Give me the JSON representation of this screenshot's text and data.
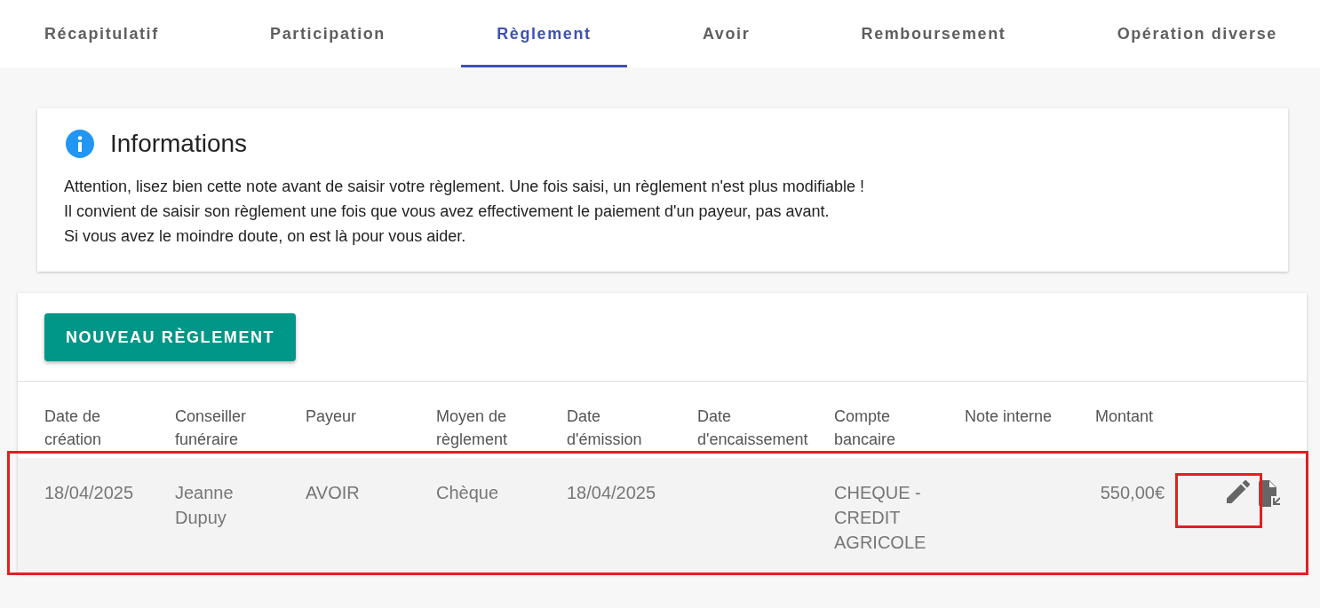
{
  "tabs": [
    {
      "label": "Récapitulatif",
      "selected": false
    },
    {
      "label": "Participation",
      "selected": false
    },
    {
      "label": "Règlement",
      "selected": true
    },
    {
      "label": "Avoir",
      "selected": false
    },
    {
      "label": "Remboursement",
      "selected": false
    },
    {
      "label": "Opération diverse",
      "selected": false
    }
  ],
  "info_card": {
    "title": "Informations",
    "lines": [
      "Attention, lisez bien cette note avant de saisir votre règlement. Une fois saisi, un règlement n'est plus modifiable !",
      "Il convient de saisir son règlement une fois que vous avez effectivement le paiement d'un payeur, pas avant.",
      "Si vous avez le moindre doute, on est là pour vous aider."
    ]
  },
  "new_button": "NOUVEAU RÈGLEMENT",
  "table": {
    "columns": [
      "Date de\ncréation",
      "Conseiller\nfunéraire",
      "Payeur",
      "Moyen de\nrèglement",
      "Date\nd'émission",
      "Date\nd'encaissement",
      "Compte\nbancaire",
      "Note interne",
      "Montant"
    ],
    "rows": [
      {
        "highlighted": true,
        "edit_highlighted": true,
        "cells": [
          "18/04/2025",
          "Jeanne Dupuy",
          "AVOIR",
          "Chèque",
          "18/04/2025",
          "",
          "CHEQUE - CREDIT AGRICOLE",
          "",
          "550,00€"
        ]
      }
    ]
  }
}
